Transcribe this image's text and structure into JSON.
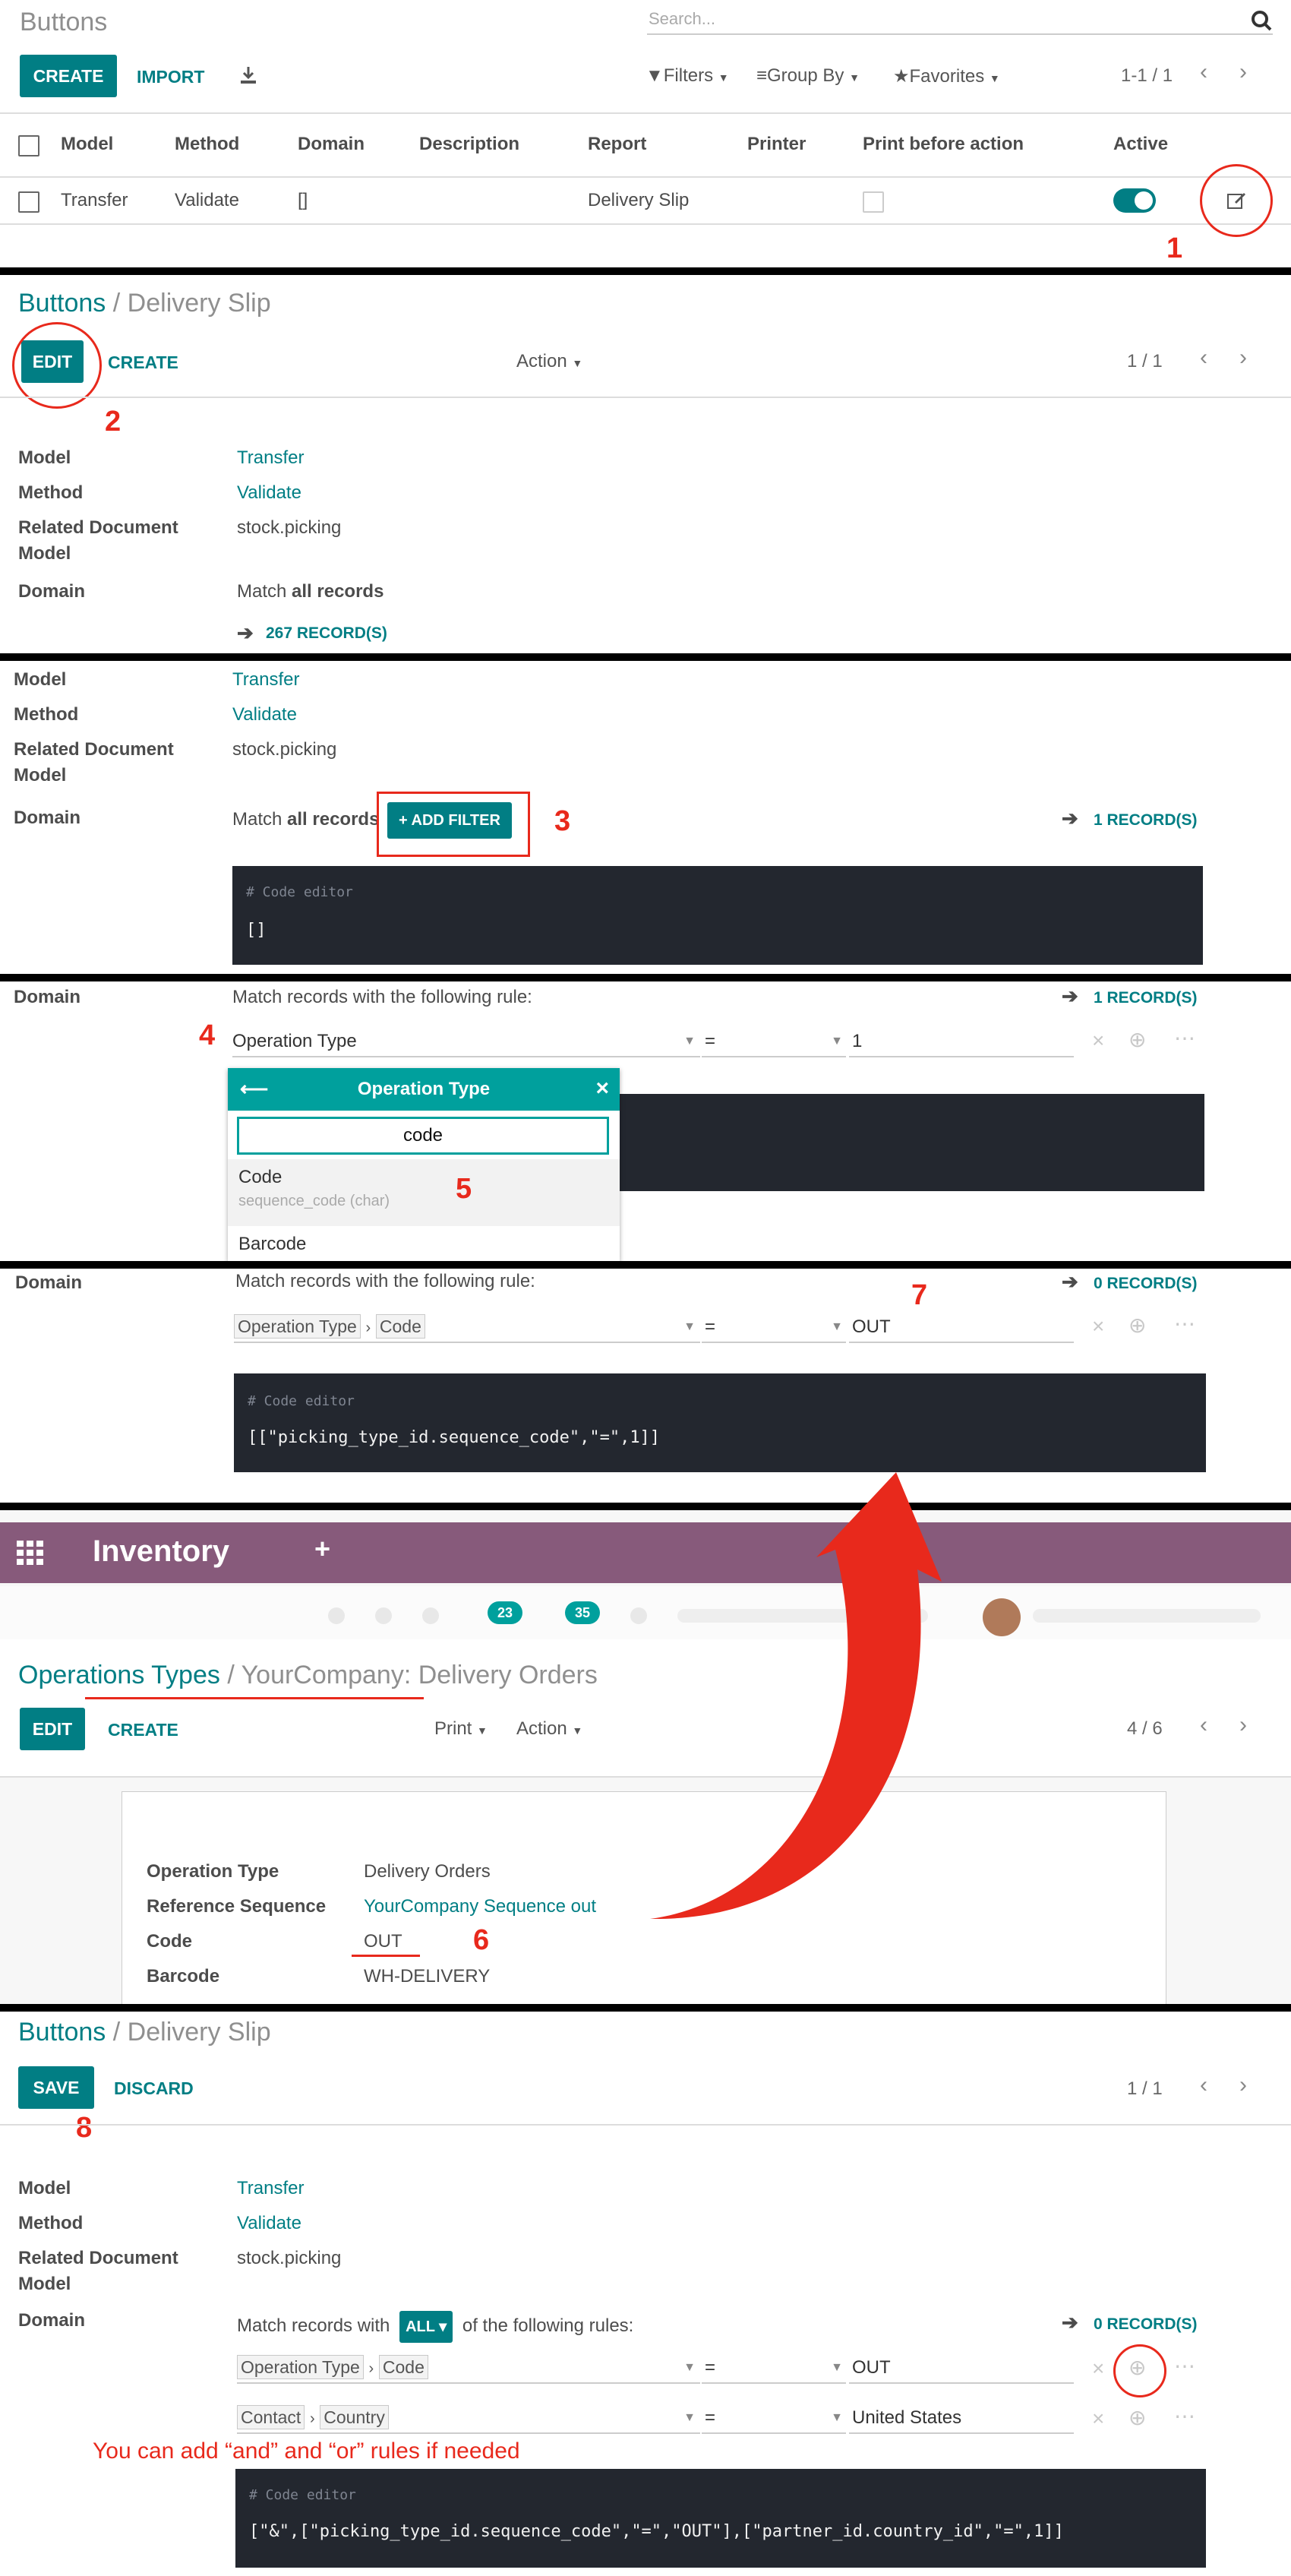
{
  "list": {
    "title": "Buttons",
    "search_placeholder": "Search...",
    "create": "CREATE",
    "import": "IMPORT",
    "filters": "Filters",
    "group_by": "Group By",
    "favorites": "Favorites",
    "pager": "1-1 / 1",
    "columns": [
      "Model",
      "Method",
      "Domain",
      "Description",
      "Report",
      "Printer",
      "Print before action",
      "Active"
    ],
    "row": {
      "model": "Transfer",
      "method": "Validate",
      "domain": "[]",
      "description": "",
      "report": "Delivery Slip",
      "printer": "",
      "print_before": false,
      "active": true
    }
  },
  "form1": {
    "breadcrumb_root": "Buttons",
    "breadcrumb_sep": "/",
    "breadcrumb_current": "Delivery Slip",
    "edit": "EDIT",
    "create": "CREATE",
    "action": "Action",
    "pager": "1 / 1",
    "model_label": "Model",
    "model": "Transfer",
    "method_label": "Method",
    "method": "Validate",
    "related_label_1": "Related Document",
    "related_label_2": "Model",
    "related": "stock.picking",
    "domain_label": "Domain",
    "match_prefix": "Match ",
    "match_bold": "all records",
    "records": "267 RECORD(S)"
  },
  "step3": {
    "model_label": "Model",
    "model": "Transfer",
    "method_label": "Method",
    "method": "Validate",
    "related_label_1": "Related Document",
    "related_label_2": "Model",
    "related": "stock.picking",
    "domain_label": "Domain",
    "match_prefix": "Match ",
    "match_bold": "all records",
    "add_filter": "+ ADD FILTER",
    "records": "1 RECORD(S)",
    "code_comment": "# Code editor",
    "code": "[]"
  },
  "step4": {
    "domain_label": "Domain",
    "rule_text": "Match records with the following rule:",
    "records": "1 RECORD(S)",
    "field": "Operation Type",
    "operator": "=",
    "value": "1",
    "popup_title": "Operation Type",
    "popup_search": "code",
    "popup_item_1": "Code",
    "popup_item_1_sub": "sequence_code (char)",
    "popup_item_2": "Barcode"
  },
  "step7": {
    "domain_label": "Domain",
    "rule_text": "Match records with the following rule:",
    "records": "0 RECORD(S)",
    "field_1": "Operation Type",
    "field_2": "Code",
    "operator": "=",
    "value": "OUT",
    "code_comment": "# Code editor",
    "code": "[[\"picking_type_id.sequence_code\",\"=\",1]]"
  },
  "inventory": {
    "app_name": "Inventory",
    "plus": "+",
    "badge_1": "23",
    "badge_2": "35",
    "breadcrumb_root": "Operations Types",
    "breadcrumb_sep": "/",
    "breadcrumb_current": "YourCompany: Delivery Orders",
    "edit": "EDIT",
    "create": "CREATE",
    "print": "Print",
    "action": "Action",
    "pager": "4 / 6",
    "op_type_label": "Operation Type",
    "op_type": "Delivery Orders",
    "ref_seq_label": "Reference Sequence",
    "ref_seq": "YourCompany Sequence out",
    "code_label": "Code",
    "code": "OUT",
    "barcode_label": "Barcode",
    "barcode": "WH-DELIVERY"
  },
  "form2": {
    "breadcrumb_root": "Buttons",
    "breadcrumb_sep": "/",
    "breadcrumb_current": "Delivery Slip",
    "save": "SAVE",
    "discard": "DISCARD",
    "pager": "1 / 1",
    "model_label": "Model",
    "model": "Transfer",
    "method_label": "Method",
    "method": "Validate",
    "related_label_1": "Related Document",
    "related_label_2": "Model",
    "related": "stock.picking",
    "domain_label": "Domain",
    "match_prefix": "Match records with",
    "all_badge": "ALL",
    "match_suffix": "of the following rules:",
    "records": "0 RECORD(S)",
    "rule1_field_1": "Operation Type",
    "rule1_field_2": "Code",
    "rule1_operator": "=",
    "rule1_value": "OUT",
    "rule2_field_1": "Contact",
    "rule2_field_2": "Country",
    "rule2_operator": "=",
    "rule2_value": "United States",
    "code_comment": "# Code editor",
    "code": "[\"&\",[\"picking_type_id.sequence_code\",\"=\",\"OUT\"],[\"partner_id.country_id\",\"=\",1]]"
  },
  "annotations": {
    "n1": "1",
    "n2": "2",
    "n3": "3",
    "n4": "4",
    "n5": "5",
    "n6": "6",
    "n7": "7",
    "n8": "8",
    "note": "You can add “and” and “or” rules if needed"
  },
  "colors": {
    "accent": "#017e84",
    "annotation": "#e8291c",
    "navbar": "#875a7b",
    "code_bg": "#23272f"
  },
  "icons": [
    "search-icon",
    "download-icon",
    "filter-icon",
    "group-by-icon",
    "star-icon",
    "chevron-left-icon",
    "chevron-right-icon",
    "edit-icon",
    "arrow-right-icon",
    "back-arrow-icon",
    "close-icon",
    "apps-grid-icon",
    "delete-icon",
    "add-icon",
    "ellipsis-icon"
  ]
}
